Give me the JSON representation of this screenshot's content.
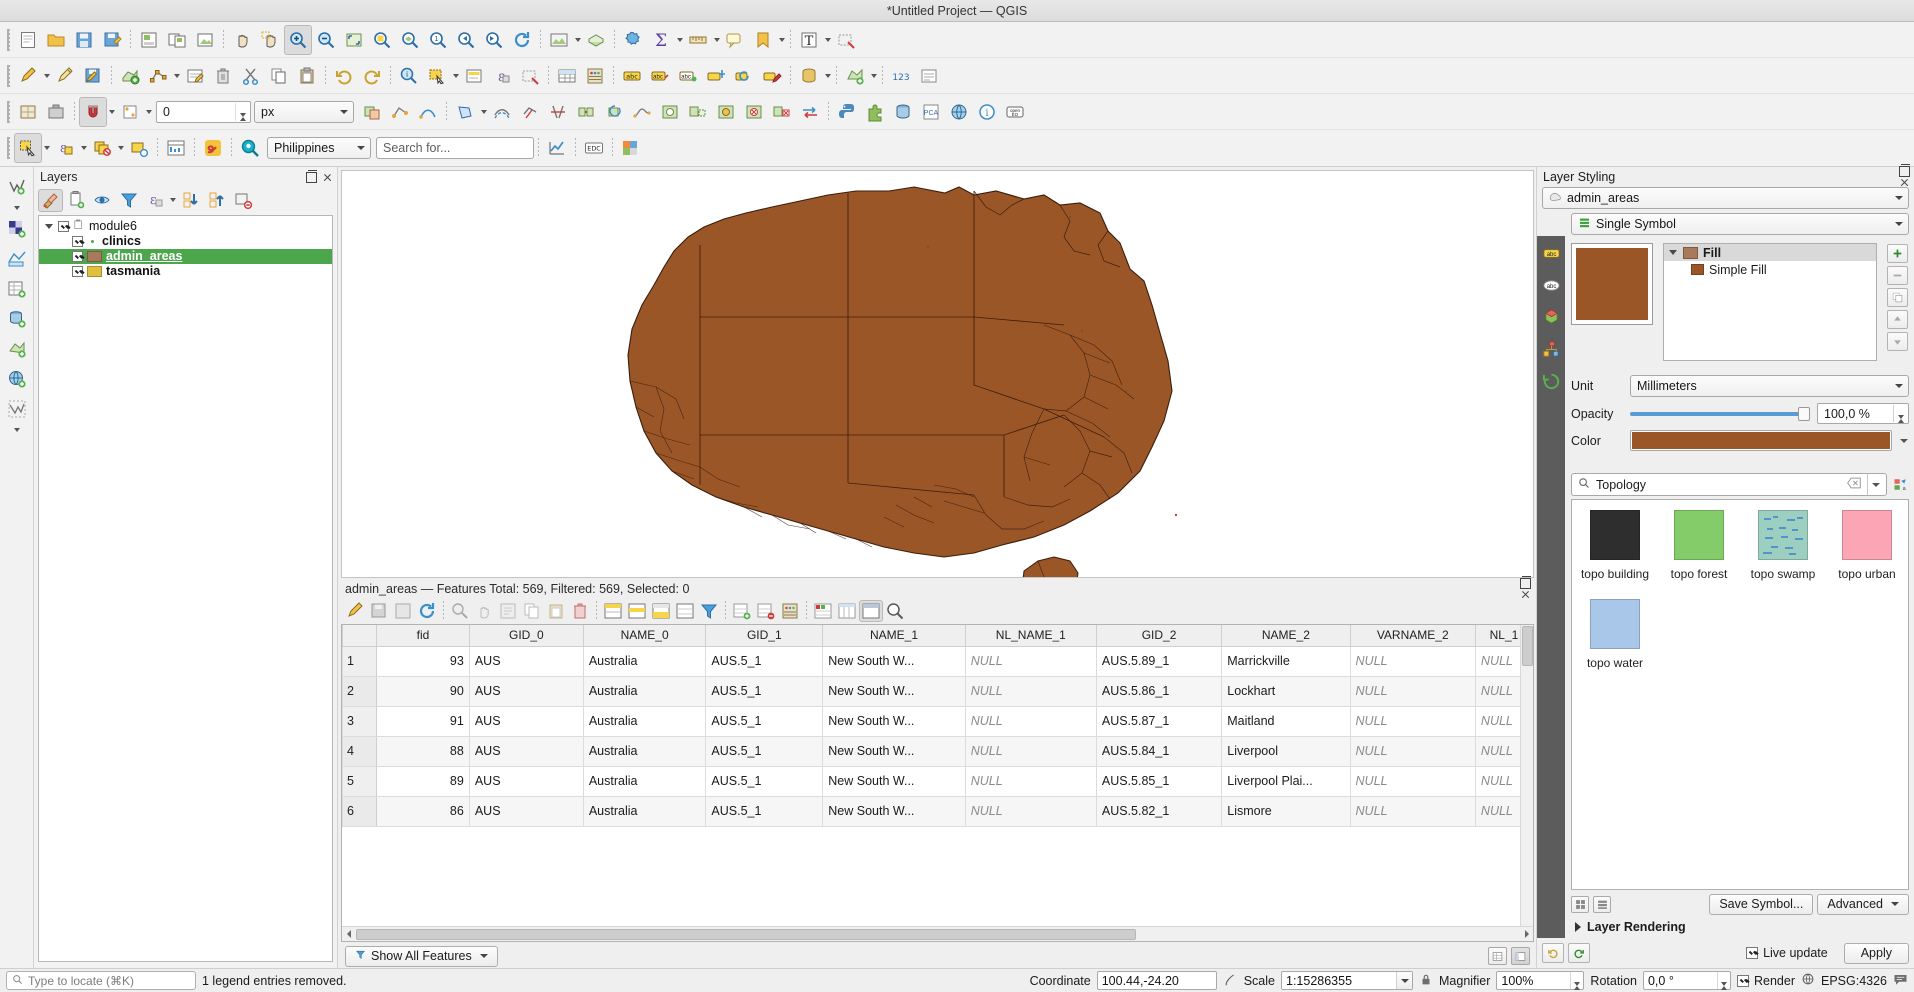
{
  "window": {
    "title": "*Untitled Project — QGIS"
  },
  "toolbars": {
    "row1": [
      {
        "name": "new-project",
        "icon": "page"
      },
      {
        "name": "open-project",
        "icon": "folder"
      },
      {
        "name": "save-project",
        "icon": "save"
      },
      {
        "name": "save-project-as",
        "icon": "save-as"
      },
      {
        "name": "new-print-layout",
        "icon": "layout"
      },
      {
        "name": "show-layout-manager",
        "icon": "layout-manager"
      },
      {
        "name": "pan-map",
        "icon": "hand"
      },
      {
        "name": "pan-to-selection",
        "icon": "pan-selection"
      },
      {
        "name": "zoom-in",
        "icon": "zoom-in"
      },
      {
        "name": "zoom-out",
        "icon": "zoom-out"
      },
      {
        "name": "zoom-full",
        "icon": "zoom-full"
      },
      {
        "name": "zoom-to-selection",
        "icon": "zoom-selection"
      },
      {
        "name": "zoom-to-layer",
        "icon": "zoom-layer"
      },
      {
        "name": "zoom-native",
        "icon": "zoom-native"
      },
      {
        "name": "zoom-last",
        "icon": "zoom-last"
      },
      {
        "name": "zoom-next",
        "icon": "zoom-next"
      },
      {
        "name": "refresh",
        "icon": "refresh"
      },
      {
        "name": "new-map-view",
        "icon": "map-view"
      },
      {
        "name": "new-3d-map-view",
        "icon": "map-3d"
      },
      {
        "name": "show-statistics",
        "icon": "sigma"
      },
      {
        "name": "measure-line",
        "icon": "ruler"
      },
      {
        "name": "show-map-tips",
        "icon": "maptip"
      },
      {
        "name": "new-bookmark",
        "icon": "bookmark"
      },
      {
        "name": "text-annotation",
        "icon": "text-annot"
      },
      {
        "name": "deselect-features",
        "icon": "deselect"
      }
    ],
    "row2": [
      {
        "name": "current-edits",
        "icon": "pencil-edits"
      },
      {
        "name": "toggle-editing",
        "icon": "pencil"
      },
      {
        "name": "save-layer-edits",
        "icon": "save-edits"
      },
      {
        "name": "add-feature",
        "icon": "add-feature"
      },
      {
        "name": "vertex-tool",
        "icon": "vertex"
      },
      {
        "name": "modify-attributes",
        "icon": "modify-attr"
      },
      {
        "name": "delete-selected",
        "icon": "trash"
      },
      {
        "name": "cut-features",
        "icon": "scissors"
      },
      {
        "name": "copy-features",
        "icon": "copy"
      },
      {
        "name": "paste-features",
        "icon": "paste"
      },
      {
        "name": "undo",
        "icon": "undo"
      },
      {
        "name": "redo",
        "icon": "redo"
      },
      {
        "name": "identify-features",
        "icon": "identify"
      },
      {
        "name": "select-features",
        "icon": "select-rect"
      },
      {
        "name": "select-by-value",
        "icon": "select-value"
      },
      {
        "name": "select-by-expression",
        "icon": "select-expr"
      },
      {
        "name": "deselect-all",
        "icon": "deselect-all"
      },
      {
        "name": "open-attribute-table",
        "icon": "attr-table"
      },
      {
        "name": "field-calculator",
        "icon": "abacus"
      },
      {
        "name": "show-labels",
        "icon": "label-abc"
      },
      {
        "name": "pin-labels",
        "icon": "pin-label"
      },
      {
        "name": "show-hide-labels",
        "icon": "show-label"
      },
      {
        "name": "move-label",
        "icon": "move-label"
      },
      {
        "name": "rotate-label",
        "icon": "rotate-label"
      },
      {
        "name": "change-label",
        "icon": "change-label"
      },
      {
        "name": "data-source-manager",
        "icon": "datasource"
      },
      {
        "name": "add-vector-layer",
        "icon": "add-vector"
      },
      {
        "name": "add-raster-layer",
        "icon": "add-raster"
      },
      {
        "name": "add-mesh-layer",
        "icon": "add-mesh"
      },
      {
        "name": "add-delimited-text",
        "icon": "add-text"
      },
      {
        "name": "add-postgis",
        "icon": "add-postgis"
      },
      {
        "name": "add-spatialite",
        "icon": "add-spatialite"
      },
      {
        "name": "add-wms",
        "icon": "add-wms"
      },
      {
        "name": "add-wcs",
        "icon": "add-wcs"
      },
      {
        "name": "add-wfs",
        "icon": "add-wfs"
      },
      {
        "name": "add-vectortile",
        "icon": "add-vectortile"
      },
      {
        "name": "add-pointcloud",
        "icon": "add-pointcloud"
      },
      {
        "name": "new-shapefile",
        "icon": "new-shp"
      },
      {
        "name": "new-geopackage",
        "icon": "new-gpkg"
      },
      {
        "name": "numeric-123",
        "icon": "numeric"
      }
    ],
    "row3": [
      {
        "name": "processing-toolbox",
        "icon": "gear-wheel"
      },
      {
        "name": "georeferencer",
        "icon": "georef"
      },
      {
        "name": "snapping-toggle",
        "icon": "magnet"
      },
      {
        "name": "snap-mode",
        "icon": "snap-mode"
      },
      {
        "name": "avoid-overlap",
        "icon": "avoid-overlap"
      },
      {
        "name": "topological-editing",
        "icon": "topo-edit"
      },
      {
        "name": "enable-tracing",
        "icon": "tracing"
      },
      {
        "name": "select-polygon",
        "icon": "select-poly"
      },
      {
        "name": "offset-curve",
        "icon": "offset-curve"
      },
      {
        "name": "reshape-features",
        "icon": "reshape"
      },
      {
        "name": "split-features",
        "icon": "split"
      },
      {
        "name": "merge-features",
        "icon": "merge"
      },
      {
        "name": "rotate-feature",
        "icon": "rotate-feature"
      },
      {
        "name": "simplify-feature",
        "icon": "simplify"
      },
      {
        "name": "add-ring",
        "icon": "add-ring"
      },
      {
        "name": "add-part",
        "icon": "add-part"
      },
      {
        "name": "fill-ring",
        "icon": "fill-ring"
      },
      {
        "name": "delete-ring",
        "icon": "delete-ring"
      },
      {
        "name": "delete-part",
        "icon": "delete-part"
      },
      {
        "name": "reverse-line",
        "icon": "reverse-line"
      },
      {
        "name": "plugin-python",
        "icon": "python"
      },
      {
        "name": "plugin-manager",
        "icon": "plugin-mgr"
      },
      {
        "name": "db-manager",
        "icon": "db-mgr"
      },
      {
        "name": "pca-plugin",
        "icon": "pca"
      },
      {
        "name": "globe-plugin",
        "icon": "globe"
      },
      {
        "name": "info-plugin",
        "icon": "info"
      },
      {
        "name": "openeo-plugin",
        "icon": "openeo"
      }
    ],
    "row4_snapping": {
      "tolerance_value": "0",
      "tolerance_unit": "px"
    },
    "row4": [
      {
        "name": "select-features-row4",
        "icon": "select-rect2"
      },
      {
        "name": "select-by-expression-row4",
        "icon": "select-expr2"
      },
      {
        "name": "select-by-form",
        "icon": "select-form"
      },
      {
        "name": "deselect-features-row4",
        "icon": "deselect2"
      },
      {
        "name": "show-statistical-summary",
        "icon": "stats-panel"
      },
      {
        "name": "snake-plugin",
        "icon": "snake"
      }
    ],
    "locator": {
      "project_selector": "Philippines",
      "search_placeholder": "Search for...",
      "plot-icon": "chart-icon",
      "edc-button": "EDC"
    }
  },
  "layers_panel": {
    "title": "Layers",
    "toolbar": [
      {
        "name": "open-layer-styling-panel",
        "icon": "paintbrush"
      },
      {
        "name": "add-group",
        "icon": "add-group"
      },
      {
        "name": "manage-map-themes",
        "icon": "eye"
      },
      {
        "name": "filter-legend",
        "icon": "funnel"
      },
      {
        "name": "filter-legend-expression",
        "icon": "expression"
      },
      {
        "name": "expand-all",
        "icon": "expand-all"
      },
      {
        "name": "collapse-all",
        "icon": "collapse-all"
      },
      {
        "name": "remove-layer",
        "icon": "remove-layer"
      }
    ],
    "tree": [
      {
        "label": "module6",
        "type": "group",
        "checked": true,
        "expanded": true,
        "selected": false,
        "indent": 0
      },
      {
        "label": "clinics",
        "type": "point",
        "checked": true,
        "selected": false,
        "indent": 1,
        "color": "#5aa05a"
      },
      {
        "label": "admin_areas",
        "type": "polygon",
        "checked": true,
        "selected": true,
        "indent": 1,
        "color": "#a8795a"
      },
      {
        "label": "tasmania",
        "type": "polygon",
        "checked": true,
        "selected": false,
        "indent": 1,
        "color": "#e0c03c"
      }
    ]
  },
  "map": {
    "fill_color": "#9b5627",
    "stroke_color": "#3b1d0c",
    "background": "#ffffff"
  },
  "attribute_table": {
    "title": "admin_areas — Features Total: 569, Filtered: 569, Selected: 0",
    "toolbar": [
      {
        "name": "toggle-editing-mode",
        "icon": "pencil"
      },
      {
        "name": "save-edits",
        "icon": "save-edits"
      },
      {
        "name": "reload-table",
        "icon": "reload"
      },
      {
        "name": "refresh-table",
        "icon": "refresh-blue"
      },
      {
        "name": "zoom-map-to-selected",
        "icon": "zoom-selected"
      },
      {
        "name": "pan-map-to-selected",
        "icon": "pan-selected"
      },
      {
        "name": "move-selection-to-top",
        "icon": "move-top"
      },
      {
        "name": "copy-selected-rows",
        "icon": "copy-rows"
      },
      {
        "name": "paste-features-table",
        "icon": "paste-rows"
      },
      {
        "name": "delete-selected-features",
        "icon": "trash-red"
      },
      {
        "name": "select-all",
        "icon": "select-all"
      },
      {
        "name": "invert-selection",
        "icon": "invert-selection"
      },
      {
        "name": "deselect-all-table",
        "icon": "deselect-all2"
      },
      {
        "name": "filter-features",
        "icon": "funnel-blue"
      },
      {
        "name": "select-by-expression-table",
        "icon": "expr-select"
      },
      {
        "name": "add-feature-table",
        "icon": "add-feature2"
      },
      {
        "name": "delete-feature-table",
        "icon": "delete-feature2"
      },
      {
        "name": "open-field-calculator",
        "icon": "calculator"
      },
      {
        "name": "new-field",
        "icon": "new-field"
      },
      {
        "name": "delete-field",
        "icon": "delete-field"
      },
      {
        "name": "conditional-formatting",
        "icon": "cond-format"
      },
      {
        "name": "organize-columns",
        "icon": "organize-cols"
      },
      {
        "name": "actions",
        "icon": "actions"
      },
      {
        "name": "dock-undock-table",
        "icon": "dock"
      },
      {
        "name": "zoom-table",
        "icon": "zoom-table"
      }
    ],
    "columns": [
      "",
      "fid",
      "GID_0",
      "NAME_0",
      "GID_1",
      "NAME_1",
      "NL_NAME_1",
      "GID_2",
      "NAME_2",
      "VARNAME_2",
      "NL_1"
    ],
    "rows": [
      {
        "n": "1",
        "fid": "93",
        "GID_0": "AUS",
        "NAME_0": "Australia",
        "GID_1": "AUS.5_1",
        "NAME_1": "New South W...",
        "NL_NAME_1": "NULL",
        "GID_2": "AUS.5.89_1",
        "NAME_2": "Marrickville",
        "VARNAME_2": "NULL",
        "NL_1": "NULL"
      },
      {
        "n": "2",
        "fid": "90",
        "GID_0": "AUS",
        "NAME_0": "Australia",
        "GID_1": "AUS.5_1",
        "NAME_1": "New South W...",
        "NL_NAME_1": "NULL",
        "GID_2": "AUS.5.86_1",
        "NAME_2": "Lockhart",
        "VARNAME_2": "NULL",
        "NL_1": "NULL"
      },
      {
        "n": "3",
        "fid": "91",
        "GID_0": "AUS",
        "NAME_0": "Australia",
        "GID_1": "AUS.5_1",
        "NAME_1": "New South W...",
        "NL_NAME_1": "NULL",
        "GID_2": "AUS.5.87_1",
        "NAME_2": "Maitland",
        "VARNAME_2": "NULL",
        "NL_1": "NULL"
      },
      {
        "n": "4",
        "fid": "88",
        "GID_0": "AUS",
        "NAME_0": "Australia",
        "GID_1": "AUS.5_1",
        "NAME_1": "New South W...",
        "NL_NAME_1": "NULL",
        "GID_2": "AUS.5.84_1",
        "NAME_2": "Liverpool",
        "VARNAME_2": "NULL",
        "NL_1": "NULL"
      },
      {
        "n": "5",
        "fid": "89",
        "GID_0": "AUS",
        "NAME_0": "Australia",
        "GID_1": "AUS.5_1",
        "NAME_1": "New South W...",
        "NL_NAME_1": "NULL",
        "GID_2": "AUS.5.85_1",
        "NAME_2": "Liverpool Plai...",
        "VARNAME_2": "NULL",
        "NL_1": "NULL"
      },
      {
        "n": "6",
        "fid": "86",
        "GID_0": "AUS",
        "NAME_0": "Australia",
        "GID_1": "AUS.5_1",
        "NAME_1": "New South W...",
        "NL_NAME_1": "NULL",
        "GID_2": "AUS.5.82_1",
        "NAME_2": "Lismore",
        "VARNAME_2": "NULL",
        "NL_1": "NULL"
      }
    ],
    "footer_button": "Show All Features"
  },
  "layer_styling": {
    "title": "Layer Styling",
    "layer_selector": "admin_areas",
    "renderer": "Single Symbol",
    "side_tabs": [
      {
        "name": "symbology-tab",
        "icon": "paintbrush",
        "active": false
      },
      {
        "name": "labels-tab",
        "icon": "label-abc",
        "active": false
      },
      {
        "name": "masks-tab",
        "icon": "abc-mask",
        "active": false
      },
      {
        "name": "3d-view-tab",
        "icon": "cube",
        "active": false
      },
      {
        "name": "diagrams-tab",
        "icon": "diagram",
        "active": false
      },
      {
        "name": "history-tab",
        "icon": "history",
        "active": false
      }
    ],
    "symbol_tree": [
      {
        "label": "Fill",
        "bold": true,
        "indent": 0,
        "selected": true,
        "color": "#9b5627"
      },
      {
        "label": "Simple Fill",
        "bold": false,
        "indent": 1,
        "selected": false,
        "color": "#9b5627"
      }
    ],
    "tree_buttons": [
      {
        "name": "add-symbol-layer",
        "icon": "plus-green"
      },
      {
        "name": "remove-symbol-layer",
        "icon": "minus-red"
      },
      {
        "name": "duplicate-symbol-layer",
        "icon": "duplicate"
      },
      {
        "name": "move-symbol-layer-up",
        "icon": "arrow-up"
      },
      {
        "name": "move-symbol-layer-down",
        "icon": "arrow-down"
      },
      {
        "name": "lock-symbol-layer",
        "icon": "lock"
      }
    ],
    "unit_label": "Unit",
    "unit_value": "Millimeters",
    "opacity_label": "Opacity",
    "opacity_value": "100,0 %",
    "color_label": "Color",
    "color_value": "#9b5627",
    "symbol_search": "Topology",
    "symbols": [
      {
        "label": "topo building",
        "color": "#2e2e2e",
        "pattern": "solid"
      },
      {
        "label": "topo forest",
        "color": "#84cc6a",
        "pattern": "solid"
      },
      {
        "label": "topo swamp",
        "color": "#9ccfc0",
        "pattern": "swamp"
      },
      {
        "label": "topo urban",
        "color": "#fba5b5",
        "pattern": "solid"
      },
      {
        "label": "topo water",
        "color": "#a9c7e8",
        "pattern": "solid"
      }
    ],
    "save_symbol_button": "Save Symbol...",
    "advanced_button": "Advanced",
    "layer_rendering_label": "Layer Rendering",
    "live_update_label": "Live update",
    "live_update_checked": true,
    "apply_button": "Apply"
  },
  "statusbar": {
    "locate_placeholder": "Type to locate (⌘K)",
    "message": "1 legend entries removed.",
    "coordinate_label": "Coordinate",
    "coordinate_value": "100.44,-24.20",
    "scale_label": "Scale",
    "scale_value": "1:15286355",
    "magnifier_label": "Magnifier",
    "magnifier_value": "100%",
    "rotation_label": "Rotation",
    "rotation_value": "0,0 °",
    "render_label": "Render",
    "render_checked": true,
    "crs_value": "EPSG:4326"
  }
}
